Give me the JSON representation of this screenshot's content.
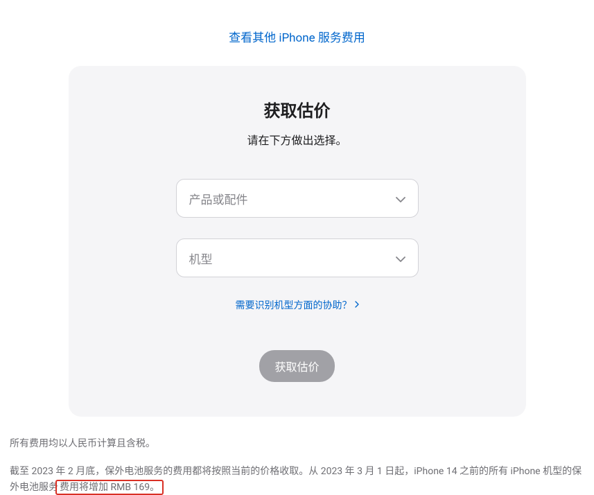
{
  "topLink": {
    "label": "查看其他 iPhone 服务费用"
  },
  "card": {
    "title": "获取估价",
    "subtitle": "请在下方做出选择。",
    "selectProduct": {
      "placeholder": "产品或配件"
    },
    "selectModel": {
      "placeholder": "机型"
    },
    "helpLink": {
      "label": "需要识别机型方面的协助？"
    },
    "submitButton": {
      "label": "获取估价"
    }
  },
  "footer": {
    "line1": "所有费用均以人民币计算且含税。",
    "line2Part1": "截至 2023 年 2 月底，保外电池服务的费用都将按照当前的价格收取。从 2023 年 3 月 1 日起，iPhone 14 之前的所有 iPhone 机型的保外电池服务",
    "line2Highlight": "费用将增加 RMB 169。"
  }
}
